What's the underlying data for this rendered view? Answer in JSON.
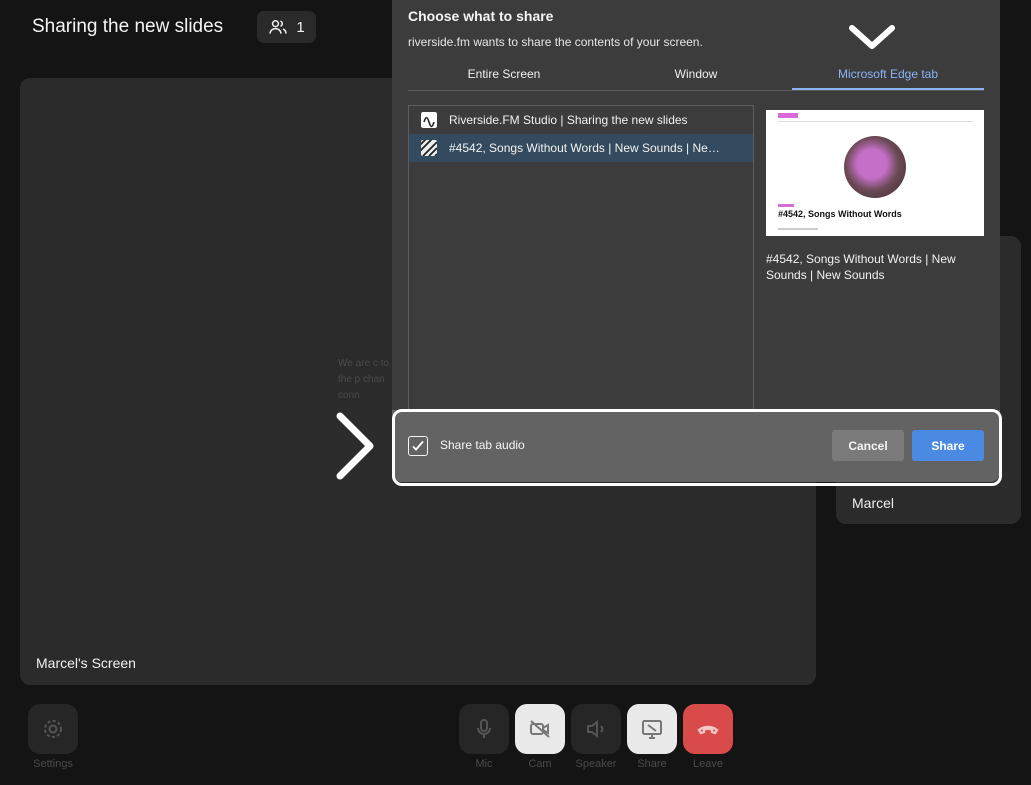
{
  "header": {
    "title": "Sharing the new slides",
    "participant_count": "1"
  },
  "stage": {
    "label": "Marcel's Screen",
    "faded_text": "We are c to the p chan conn"
  },
  "side_card": {
    "name": "Marcel"
  },
  "controls": {
    "settings": "Settings",
    "mic": "Mic",
    "cam": "Cam",
    "speaker": "Speaker",
    "share": "Share",
    "leave": "Leave"
  },
  "dialog": {
    "title": "Choose what to share",
    "subtitle": "riverside.fm wants to share the contents of your screen.",
    "tabs": [
      "Entire Screen",
      "Window",
      "Microsoft Edge tab"
    ],
    "active_tab": "Microsoft Edge tab",
    "items": [
      {
        "label": "Riverside.FM Studio | Sharing the new slides",
        "selected": false
      },
      {
        "label": "#4542, Songs Without Words | New Sounds | Ne…",
        "selected": true
      }
    ],
    "preview_title": "#4542, Songs Without Words",
    "preview_caption": "#4542, Songs Without Words | New Sounds | New Sounds",
    "share_audio_label": "Share tab audio",
    "share_audio_checked": true,
    "cancel": "Cancel",
    "share": "Share"
  },
  "colors": {
    "accent": "#8ab4f8",
    "share_button": "#4a8ae3",
    "leave_button": "#d94a4a"
  }
}
